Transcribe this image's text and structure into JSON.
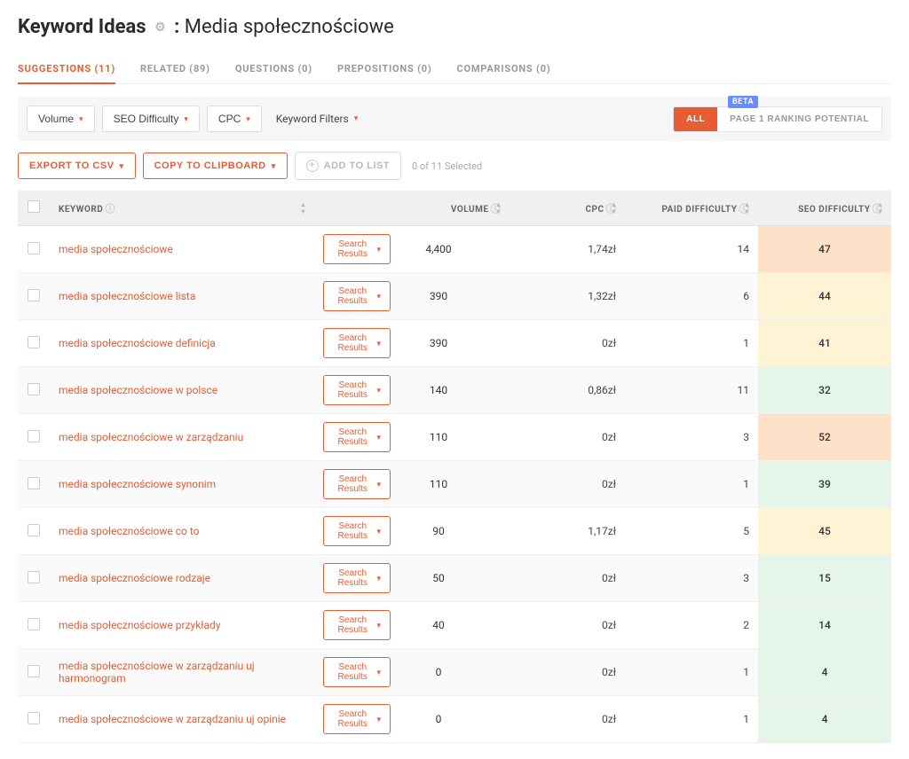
{
  "header": {
    "title": "Keyword Ideas",
    "subject": "Media społecznościowe"
  },
  "tabs": [
    {
      "label": "SUGGESTIONS (11)",
      "active": true
    },
    {
      "label": "RELATED (89)",
      "active": false
    },
    {
      "label": "QUESTIONS (0)",
      "active": false
    },
    {
      "label": "PREPOSITIONS (0)",
      "active": false
    },
    {
      "label": "COMPARISONS (0)",
      "active": false
    }
  ],
  "filters": {
    "volume": "Volume",
    "seo_difficulty": "SEO Difficulty",
    "cpc": "CPC",
    "keyword_filters": "Keyword Filters",
    "beta": "BETA",
    "toggle_all": "ALL",
    "toggle_page1": "PAGE 1 RANKING POTENTIAL"
  },
  "actions": {
    "export": "EXPORT TO CSV",
    "clipboard": "COPY TO CLIPBOARD",
    "add_to_list": "ADD TO LIST",
    "selected": "0 of 11 Selected"
  },
  "table": {
    "headers": {
      "keyword": "KEYWORD",
      "volume": "VOLUME",
      "cpc": "CPC",
      "paid_difficulty": "PAID DIFFICULTY",
      "seo_difficulty": "SEO DIFFICULTY"
    },
    "search_results_label": "Search Results",
    "rows": [
      {
        "keyword": "media społecznościowe",
        "volume": "4,400",
        "cpc": "1,74zł",
        "paid": "14",
        "seo": "47",
        "seo_class": "seo-orange"
      },
      {
        "keyword": "media społecznościowe lista",
        "volume": "390",
        "cpc": "1,32zł",
        "paid": "6",
        "seo": "44",
        "seo_class": "seo-yellow"
      },
      {
        "keyword": "media społecznościowe definicja",
        "volume": "390",
        "cpc": "0zł",
        "paid": "1",
        "seo": "41",
        "seo_class": "seo-yellow"
      },
      {
        "keyword": "media społecznościowe w polsce",
        "volume": "140",
        "cpc": "0,86zł",
        "paid": "11",
        "seo": "32",
        "seo_class": "seo-green"
      },
      {
        "keyword": "media społecznościowe w zarządzaniu",
        "volume": "110",
        "cpc": "0zł",
        "paid": "3",
        "seo": "52",
        "seo_class": "seo-orange"
      },
      {
        "keyword": "media społecznościowe synonim",
        "volume": "110",
        "cpc": "0zł",
        "paid": "1",
        "seo": "39",
        "seo_class": "seo-green"
      },
      {
        "keyword": "media społecznościowe co to",
        "volume": "90",
        "cpc": "1,17zł",
        "paid": "5",
        "seo": "45",
        "seo_class": "seo-yellow"
      },
      {
        "keyword": "media społecznościowe rodzaje",
        "volume": "50",
        "cpc": "0zł",
        "paid": "3",
        "seo": "15",
        "seo_class": "seo-green"
      },
      {
        "keyword": "media społecznościowe przykłady",
        "volume": "40",
        "cpc": "0zł",
        "paid": "2",
        "seo": "14",
        "seo_class": "seo-green"
      },
      {
        "keyword": "media społecznościowe w zarządzaniu uj harmonogram",
        "volume": "0",
        "cpc": "0zł",
        "paid": "1",
        "seo": "4",
        "seo_class": "seo-green"
      },
      {
        "keyword": "media społecznościowe w zarządzaniu uj opinie",
        "volume": "0",
        "cpc": "0zł",
        "paid": "1",
        "seo": "4",
        "seo_class": "seo-green"
      }
    ]
  }
}
